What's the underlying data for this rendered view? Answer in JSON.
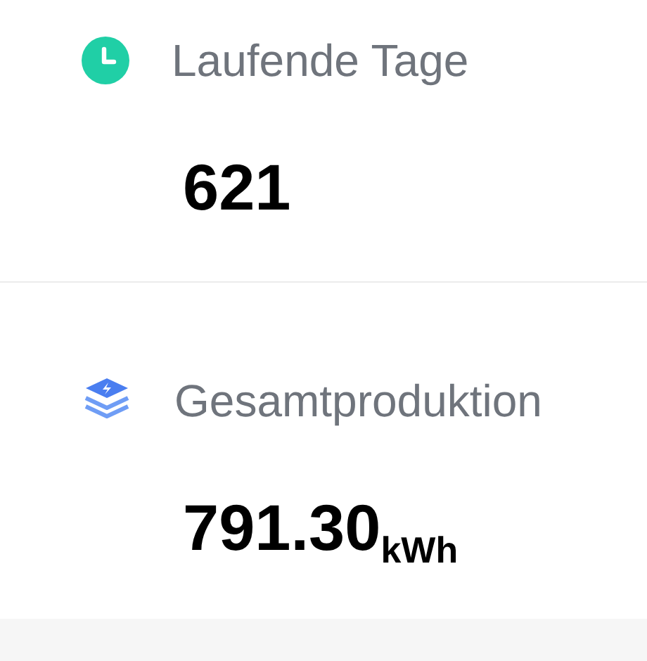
{
  "stats": [
    {
      "kind": "clock",
      "label": "Laufende Tage",
      "value": "621"
    },
    {
      "kind": "stack",
      "label": "Gesamtproduktion",
      "value": "791.30",
      "unit": "kWh"
    }
  ]
}
